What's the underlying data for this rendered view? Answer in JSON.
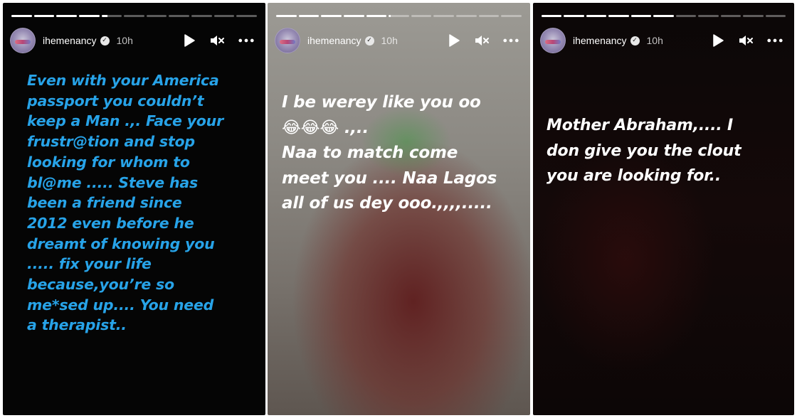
{
  "stories": [
    {
      "username": "ihemenancy",
      "time": "10h",
      "progress_segments": 11,
      "progress_current_index": 4,
      "progress_current_fraction": 0.3,
      "caption": "Even with your America\npassport you couldn’t\nkeep a Man .,. Face your\nfrustr@tion and stop\nlooking for whom to\nbl@me ..... Steve has\nbeen a friend since\n2012 even before he\ndreamt of knowing you\n..... fix your life\nbecause,you’re so\nme*sed up.... You need\na therapist..",
      "caption_color": "#27a3e8"
    },
    {
      "username": "ihemenancy",
      "time": "10h",
      "progress_segments": 11,
      "progress_current_index": 5,
      "progress_current_fraction": 0.1,
      "caption": "I be werey like you oo\n😂😂😂 .,..\nNaa to match come\nmeet you .... Naa Lagos\nall of us dey ooo.,,,,.....",
      "caption_color": "#ffffff"
    },
    {
      "username": "ihemenancy",
      "time": "10h",
      "progress_segments": 11,
      "progress_current_index": 6,
      "progress_current_fraction": 0.0,
      "caption": "Mother Abraham,.... I\ndon give you the clout\nyou are looking for..",
      "caption_color": "#ffffff"
    }
  ],
  "icons": {
    "play": "play-icon",
    "mute": "muted-speaker-icon",
    "more": "more-options-icon",
    "verified": "verified-badge-icon"
  }
}
